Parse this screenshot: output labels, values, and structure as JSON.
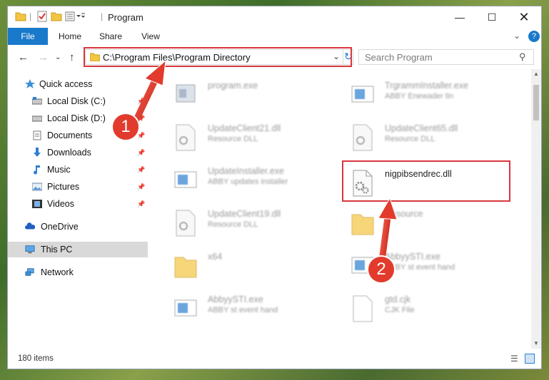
{
  "window": {
    "title": "Program"
  },
  "ribbon": {
    "tabs": [
      "File",
      "Home",
      "Share",
      "View"
    ]
  },
  "nav": {
    "address": "C:\\Program Files\\Program Directory",
    "search_placeholder": "Search Program"
  },
  "sidebar": {
    "items": [
      {
        "label": "Quick access",
        "icon": "star-icon"
      },
      {
        "label": "Local Disk (C:)",
        "icon": "drive-icon"
      },
      {
        "label": "Local Disk (D:)",
        "icon": "drive-icon"
      },
      {
        "label": "Documents",
        "icon": "documents-icon"
      },
      {
        "label": "Downloads",
        "icon": "download-icon"
      },
      {
        "label": "Music",
        "icon": "music-icon"
      },
      {
        "label": "Pictures",
        "icon": "pictures-icon"
      },
      {
        "label": "Videos",
        "icon": "videos-icon"
      },
      {
        "label": "OneDrive",
        "icon": "cloud-icon"
      },
      {
        "label": "This PC",
        "icon": "computer-icon"
      },
      {
        "label": "Network",
        "icon": "network-icon"
      }
    ]
  },
  "files": [
    {
      "name": "program.exe",
      "desc": ""
    },
    {
      "name": "TrgrammInstaller.exe",
      "desc": "ABBY Enewader tin"
    },
    {
      "name": "UpdateClient21.dll",
      "desc": "Resource DLL"
    },
    {
      "name": "UpdateClient65.dll",
      "desc": "Resource DLL"
    },
    {
      "name": "UpdateInstaller.exe",
      "desc": "ABBY updates installer"
    },
    {
      "name": "nigpibsendrec.dll",
      "desc": ""
    },
    {
      "name": "UpdateClient19.dll",
      "desc": "Resource DLL"
    },
    {
      "name": "Resource",
      "desc": ""
    },
    {
      "name": "x64",
      "desc": ""
    },
    {
      "name": "AbbyySTI.exe",
      "desc": "ABBY st event hand"
    },
    {
      "name": "AbbyySTI.exe",
      "desc": "ABBY st event hand"
    },
    {
      "name": "gtd.cjk",
      "desc": "CJK File"
    }
  ],
  "status": {
    "count": "180 items"
  },
  "annotations": {
    "step1": "1",
    "step2": "2",
    "color": "#e23a2c"
  }
}
